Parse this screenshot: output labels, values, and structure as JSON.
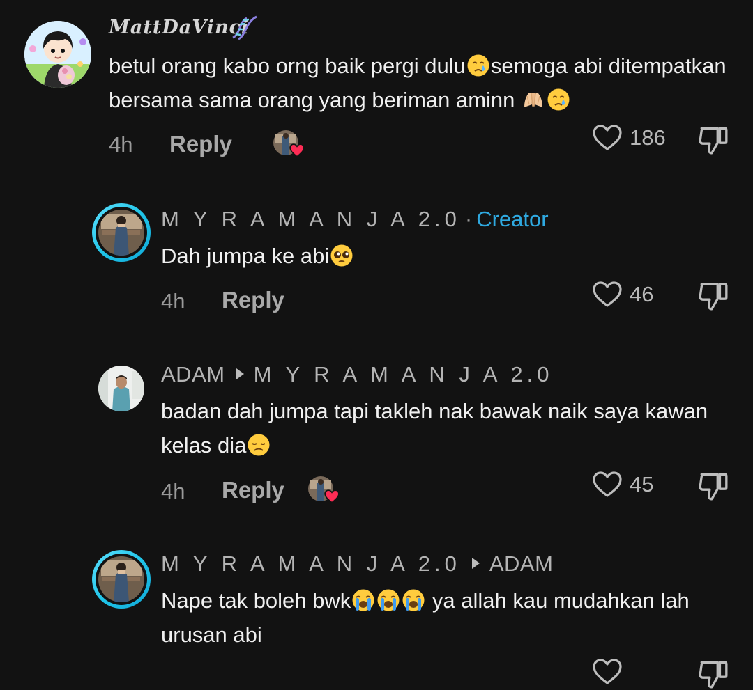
{
  "comments": [
    {
      "username": "MattDaVinci",
      "text_parts": [
        "betul orang kabo orng baik pergi dulu",
        "semoga abi ditempatkan bersama sama orang yang beriman aminn "
      ],
      "time": "4h",
      "reply_label": "Reply",
      "likes": "186",
      "liked_by_creator": true
    },
    {
      "username": "M Y R A M A N J A 2.0",
      "badge_separator": "·",
      "badge": "Creator",
      "text": "Dah jumpa ke abi",
      "time": "4h",
      "reply_label": "Reply",
      "likes": "46",
      "liked_by_creator": false
    },
    {
      "username": "ADAM",
      "reply_to": "M Y R A M A N J A 2.0",
      "text_parts": [
        "badan dah jumpa tapi takleh nak bawak naik saya kawan kelas dia"
      ],
      "time": "4h",
      "reply_label": "Reply",
      "likes": "45",
      "liked_by_creator": true
    },
    {
      "username": "M Y R A M A N J A 2.0",
      "reply_to": "ADAM",
      "text_parts": [
        "Nape tak boleh bwk",
        " ya allah kau mudahkan lah urusan abi"
      ],
      "time": "",
      "reply_label": "",
      "likes": "",
      "liked_by_creator": false
    }
  ],
  "icons": {
    "like": "heart-outline-icon",
    "dislike": "thumbs-down-outline-icon",
    "creator_liked": "creator-heart-badge-icon",
    "emoji": [
      "face-with-tear-emoji",
      "folded-hands-emoji",
      "pleading-face-emoji",
      "disappointed-face-emoji",
      "loudly-crying-face-emoji"
    ]
  },
  "colors": {
    "background": "#121212",
    "creator_badge": "#2fa9e0",
    "heart_badge": "#fe2c55",
    "ring": "#20c5e8"
  }
}
